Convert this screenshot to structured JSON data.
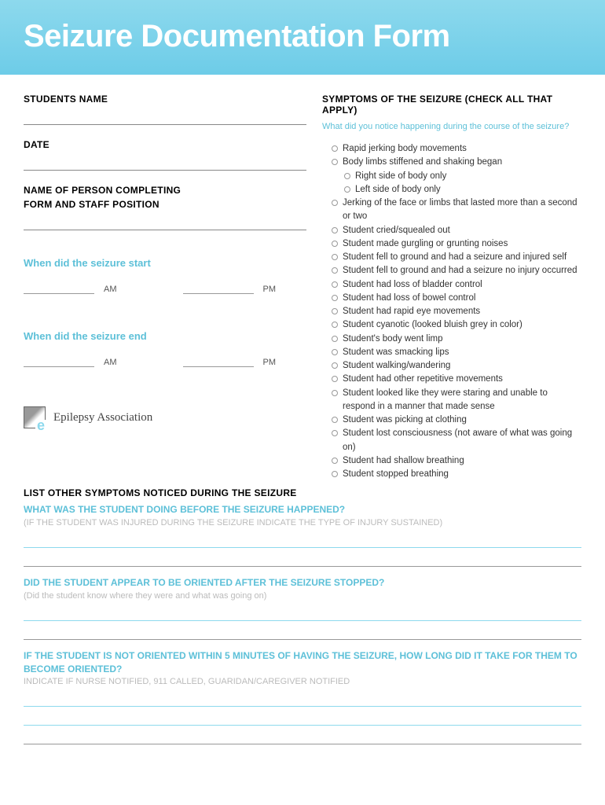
{
  "header": {
    "title": "Seizure Documentation Form"
  },
  "left": {
    "students_name_label": "STUDENTS NAME",
    "date_label": "DATE",
    "person_label_line1": "NAME OF PERSON COMPLETING",
    "person_label_line2": "FORM AND STAFF POSITION",
    "start_label": "When did the seizure start",
    "end_label": "When did the seizure end",
    "am": "AM",
    "pm": "PM",
    "logo_text": "Epilepsy Association"
  },
  "right": {
    "heading": "SYMPTOMS OF THE SEIZURE  (CHECK ALL THAT APPLY)",
    "prompt": "What did you notice happening during the course of the seizure?",
    "items": [
      "Rapid jerking body movements",
      "Body limbs stiffened and shaking began",
      "Right side of body only",
      "Left side of body only",
      "Jerking of the face or limbs that lasted more than a second or two",
      "Student cried/squealed out",
      "Student made gurgling or grunting noises",
      "Student fell to ground and had a seizure and injured self",
      "Student fell to ground and had a seizure no injury occurred",
      "Student had loss of bladder control",
      "Student had loss of bowel control",
      "Student had rapid eye movements",
      "Student cyanotic (looked bluish grey in color)",
      "Student's body went limp",
      "Student was smacking lips",
      "Student walking/wandering",
      "Student had other repetitive movements",
      "Student looked like they were staring and unable to respond in a manner that made sense",
      "Student was picking at clothing",
      "Student lost consciousness (not aware of what was going on)",
      "Student had shallow breathing",
      "Student stopped breathing"
    ]
  },
  "bottom": {
    "list_other": "LIST OTHER SYMPTOMS NOTICED DURING THE SEIZURE",
    "q1": "WHAT WAS THE STUDENT DOING BEFORE THE SEIZURE HAPPENED?",
    "q1_sub": "(IF THE STUDENT WAS INJURED DURING THE SEIZURE INDICATE THE TYPE OF INJURY SUSTAINED)",
    "q2": "DID THE STUDENT APPEAR TO BE ORIENTED AFTER THE SEIZURE STOPPED?",
    "q2_sub": "(Did the student know where they were and what was going on)",
    "q3": "IF THE STUDENT IS NOT ORIENTED WITHIN 5 MINUTES OF HAVING THE SEIZURE, HOW LONG DID IT TAKE FOR THEM TO BECOME ORIENTED?",
    "q3_sub": "INDICATE IF NURSE NOTIFIED, 911 CALLED, GUARIDAN/CAREGIVER NOTIFIED"
  }
}
